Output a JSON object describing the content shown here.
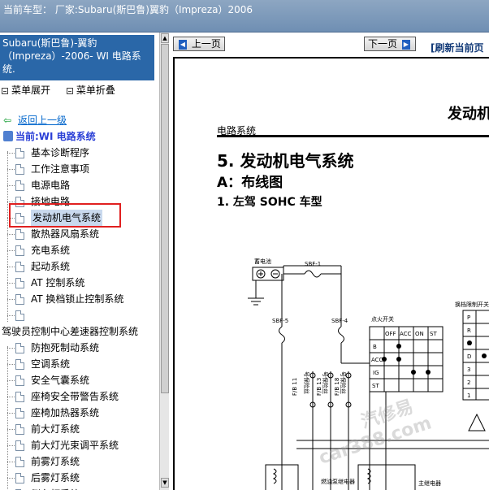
{
  "window": {
    "title": "当前车型： 厂家:Subaru(斯巴鲁)翼豹（Impreza）2006"
  },
  "left": {
    "header": "Subaru(斯巴鲁)-翼豹（Impreza）-2006- WI 电路系统.",
    "menu_expand": "菜单展开",
    "menu_collapse": "菜单折叠",
    "back_link": "返回上一级",
    "current": "当前:WI 电路系统",
    "items": [
      "基本诊断程序",
      "工作注意事项",
      "电源电路",
      "接地电路",
      "发动机电气系统",
      "散热器风扇系统",
      "充电系统",
      "起动系统",
      "AT 控制系统",
      "AT 换档锁止控制系统",
      ""
    ],
    "group2_title": "驾驶员控制中心差速器控制系统",
    "items2": [
      "防抱死制动系统",
      "空调系统",
      "安全气囊系统",
      "座椅安全带警告系统",
      "座椅加热器系统",
      "前大灯系统",
      "前大灯光束调平系统",
      "前雾灯系统",
      "后雾灯系统",
      "倒车灯系统"
    ],
    "selected_index": 4
  },
  "right": {
    "prev_label": "上一页",
    "next_label": "下一页",
    "refresh_label": "[刷新当前页",
    "doc": {
      "section_title": "发动机",
      "sub_label": "电路系统",
      "h1": "5. 发动机电气系统",
      "h2": "A：布线图",
      "h3": "1. 左驾 SOHC 车型",
      "labels": {
        "battery": "蓄电池",
        "sbf1": "SBF-1",
        "sbf5": "SBF-5",
        "sbf4": "SBF-4",
        "ign": "点火开关",
        "off": "OFF",
        "acc": "ACC",
        "on": "ON",
        "st": "ST",
        "b": "B",
        "acc2": "ACC",
        "ig": "IG",
        "st2": "ST",
        "inhibitor": "换档限制开关",
        "p": "P",
        "r": "R",
        "n": "N",
        "d": "D",
        "three": "3",
        "two": "2",
        "one": "1",
        "fb11": "F/B 11",
        "fb13": "F/B 13",
        "fb18": "F/B 18",
        "fuse_no": "号保险丝",
        "fuel_pump_relay": "燃油泵继电器",
        "main_relay": "主继电器"
      },
      "watermark1": "汽修易",
      "watermark2": "car388.com"
    }
  }
}
